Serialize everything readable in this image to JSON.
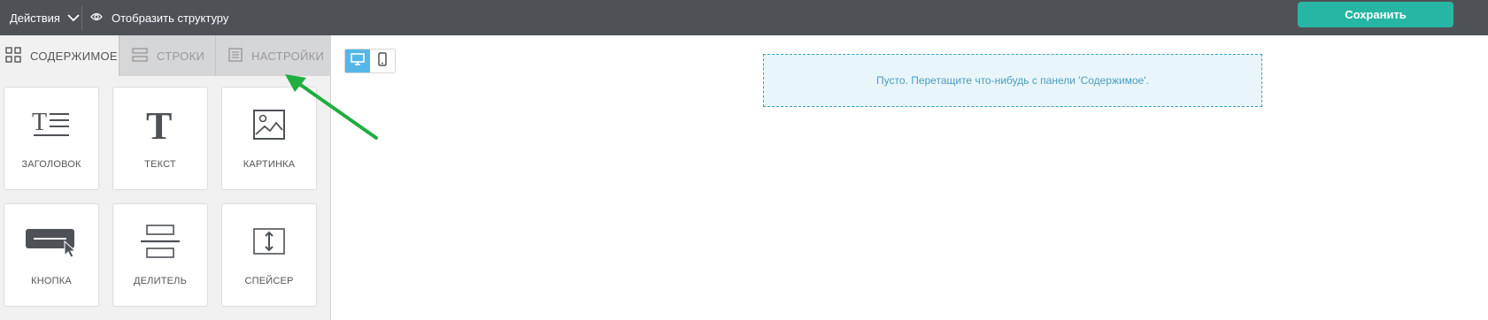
{
  "topbar": {
    "actions_label": "Действия",
    "structure_label": "Отобразить структуру",
    "save_label": "Сохранить"
  },
  "sidebar": {
    "tabs": [
      {
        "label": "СОДЕРЖИМОЕ",
        "icon": "grid-icon",
        "active": true
      },
      {
        "label": "СТРОКИ",
        "icon": "rows-icon",
        "active": false
      },
      {
        "label": "НАСТРОЙКИ",
        "icon": "settings-icon",
        "active": false
      }
    ],
    "tiles": [
      {
        "label": "ЗАГОЛОВОК",
        "icon": "heading-icon"
      },
      {
        "label": "ТЕКСТ",
        "icon": "text-icon"
      },
      {
        "label": "КАРТИНКА",
        "icon": "image-icon"
      },
      {
        "label": "КНОПКА",
        "icon": "button-icon"
      },
      {
        "label": "ДЕЛИТЕЛЬ",
        "icon": "divider-icon"
      },
      {
        "label": "СПЕЙСЕР",
        "icon": "spacer-icon"
      }
    ]
  },
  "canvas": {
    "device_modes": [
      "desktop",
      "mobile"
    ],
    "active_device": "desktop",
    "empty_message": "Пусто. Перетащите что-нибудь с панели 'Содержимое'."
  },
  "colors": {
    "topbar_bg": "#4e5257",
    "save_button": "#27b6a4",
    "active_device": "#55b7e8",
    "dropzone_border": "#3a9fc7",
    "annotation_arrow": "#1fae3f"
  }
}
